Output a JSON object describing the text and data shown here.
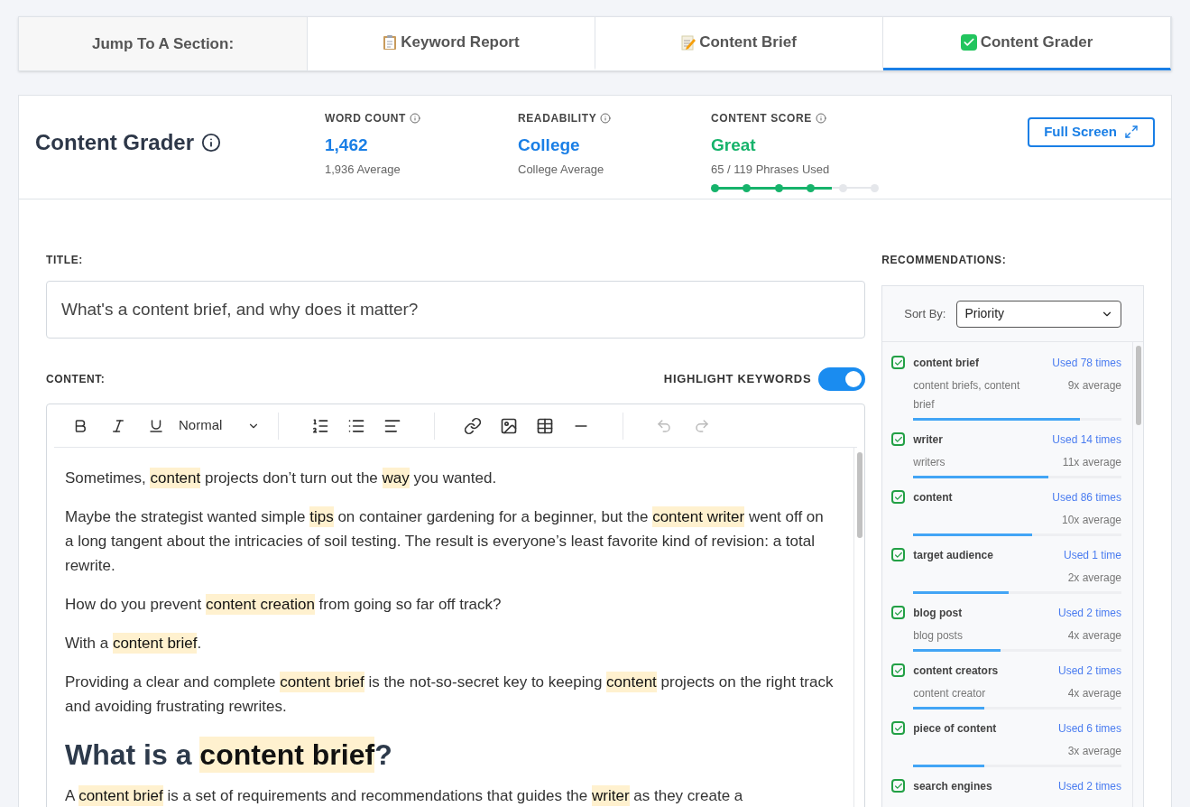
{
  "nav": {
    "label": "Jump To A Section:",
    "tabs": [
      {
        "kind": "clipboard",
        "label": "Keyword Report",
        "selected": false
      },
      {
        "kind": "memo",
        "label": "Content Brief",
        "selected": false
      },
      {
        "kind": "check",
        "label": "Content Grader",
        "selected": true
      }
    ]
  },
  "header": {
    "title": "Content Grader",
    "stats": [
      {
        "label": "WORD COUNT",
        "value": "1,462",
        "note": "1,936 Average",
        "color": "#1a7fe6"
      },
      {
        "label": "READABILITY",
        "value": "College",
        "note": "College Average",
        "color": "#1a7fe6"
      },
      {
        "label": "CONTENT SCORE",
        "value": "Great",
        "note": "65 / 119 Phrases Used",
        "color": "#16b36b",
        "steps": [
          {
            "reached": true
          },
          {
            "reached": true
          },
          {
            "reached": true
          },
          {
            "reached": true
          },
          {
            "reached": false
          },
          {
            "reached": false
          }
        ]
      }
    ],
    "button": "Full Screen"
  },
  "editor": {
    "title_label": "TITLE:",
    "title_value": "What's a content brief, and why does it matter?",
    "content_label": "CONTENT:",
    "highlight": {
      "label": "HIGHLIGHT KEYWORDS",
      "on": true
    },
    "format": "Normal",
    "blocks": [
      {
        "kind": "p",
        "segments": [
          {
            "kind": "plain",
            "text": "Sometimes, "
          },
          {
            "kind": "keyword",
            "text": "content"
          },
          {
            "kind": "plain",
            "text": " projects don’t turn out the "
          },
          {
            "kind": "keyword",
            "text": "way"
          },
          {
            "kind": "plain",
            "text": " you wanted."
          }
        ]
      },
      {
        "kind": "p",
        "segments": [
          {
            "kind": "plain",
            "text": "Maybe the strategist wanted simple "
          },
          {
            "kind": "keyword",
            "text": "tips"
          },
          {
            "kind": "plain",
            "text": " on container gardening for a beginner, but the "
          },
          {
            "kind": "keyword",
            "text": "content writer"
          },
          {
            "kind": "plain",
            "text": " went off on a long tangent about the intricacies of soil testing. The result is everyone’s least favorite kind of revision: a total rewrite."
          }
        ]
      },
      {
        "kind": "p",
        "segments": [
          {
            "kind": "plain",
            "text": "How do you prevent "
          },
          {
            "kind": "keyword",
            "text": "content creation"
          },
          {
            "kind": "plain",
            "text": " from going so far off track?"
          }
        ]
      },
      {
        "kind": "p",
        "segments": [
          {
            "kind": "plain",
            "text": "With a "
          },
          {
            "kind": "keyword",
            "text": "content brief"
          },
          {
            "kind": "plain",
            "text": "."
          }
        ]
      },
      {
        "kind": "p",
        "segments": [
          {
            "kind": "plain",
            "text": "Providing a clear and complete "
          },
          {
            "kind": "keyword",
            "text": "content brief"
          },
          {
            "kind": "plain",
            "text": " is the not-so-secret key to keeping "
          },
          {
            "kind": "keyword",
            "text": "content"
          },
          {
            "kind": "plain",
            "text": " projects on the right track and avoiding frustrating rewrites."
          }
        ]
      },
      {
        "kind": "h2",
        "segments": [
          {
            "kind": "plain",
            "text": "What is a "
          },
          {
            "kind": "keyword",
            "text": "content brief"
          },
          {
            "kind": "plain",
            "text": "?"
          }
        ]
      },
      {
        "kind": "p",
        "segments": [
          {
            "kind": "plain",
            "text": "A "
          },
          {
            "kind": "keyword",
            "text": "content brief"
          },
          {
            "kind": "plain",
            "text": " is a set of requirements and recommendations that guides the "
          },
          {
            "kind": "keyword",
            "text": "writer"
          },
          {
            "kind": "plain",
            "text": " as they create a"
          }
        ]
      }
    ]
  },
  "recommendations": {
    "label": "RECOMMENDATIONS:",
    "sort_label": "Sort By:",
    "sort_value": "Priority",
    "items": [
      {
        "phrase": "content brief",
        "variants": "content briefs, content brief",
        "used": "Used 78 times",
        "average": "9x average",
        "level": 0.8,
        "checked": true
      },
      {
        "phrase": "writer",
        "variants": "writers",
        "used": "Used 14 times",
        "average": "11x average",
        "level": 0.65,
        "checked": true
      },
      {
        "phrase": "content",
        "used": "Used 86 times",
        "average": "10x average",
        "level": 0.57,
        "checked": true
      },
      {
        "phrase": "target audience",
        "used": "Used 1 time",
        "average": "2x average",
        "level": 0.46,
        "checked": true
      },
      {
        "phrase": "blog post",
        "variants": "blog posts",
        "used": "Used 2 times",
        "average": "4x average",
        "level": 0.42,
        "checked": true
      },
      {
        "phrase": "content creators",
        "variants": "content creator",
        "used": "Used 2 times",
        "average": "4x average",
        "level": 0.34,
        "checked": true
      },
      {
        "phrase": "piece of content",
        "used": "Used 6 times",
        "average": "3x average",
        "level": 0.34,
        "checked": true
      },
      {
        "phrase": "search engines",
        "used": "Used 2 times",
        "checked": true
      }
    ]
  }
}
